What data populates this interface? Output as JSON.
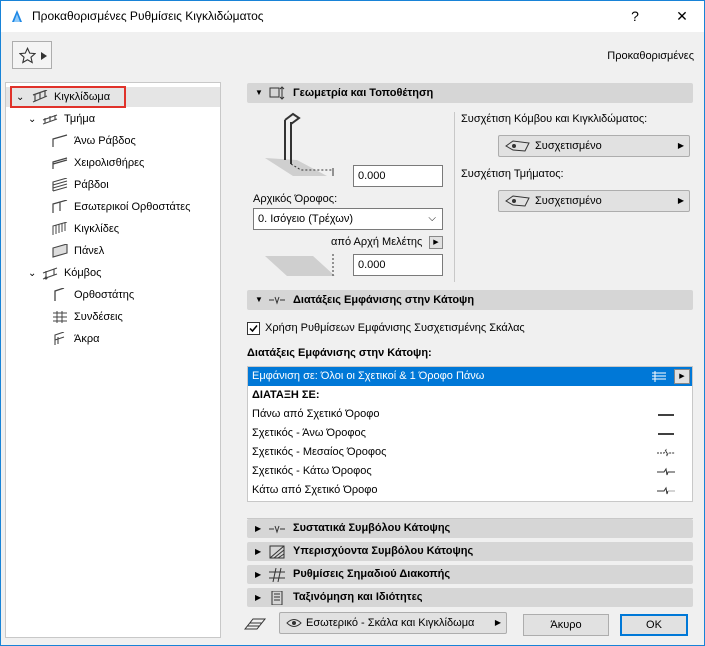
{
  "window": {
    "title": "Προκαθορισμένες Ρυθμίσεις Κιγκλιδώματος",
    "help_label": "?",
    "close_label": "✕"
  },
  "toolbar": {
    "favorites_icon": "star-icon",
    "mode_label": "Προκαθορισμένες"
  },
  "tree": {
    "root": {
      "label": "Κιγκλίδωμα",
      "icon": "railing-icon"
    },
    "segment": {
      "label": "Τμήμα",
      "icon": "segment-icon"
    },
    "segment_children": [
      {
        "label": "Άνω Ράβδος",
        "icon": "top-rail-icon"
      },
      {
        "label": "Χειρολισθήρες",
        "icon": "handrail-icon"
      },
      {
        "label": "Ράβδοι",
        "icon": "rails-icon"
      },
      {
        "label": "Εσωτερικοί Ορθοστάτες",
        "icon": "inner-post-icon"
      },
      {
        "label": "Κιγκλίδες",
        "icon": "baluster-icon"
      },
      {
        "label": "Πάνελ",
        "icon": "panel-icon"
      }
    ],
    "node": {
      "label": "Κόμβος",
      "icon": "node-icon"
    },
    "node_children": [
      {
        "label": "Ορθοστάτης",
        "icon": "post-icon"
      },
      {
        "label": "Συνδέσεις",
        "icon": "connections-icon"
      },
      {
        "label": "Άκρα",
        "icon": "ends-icon"
      }
    ]
  },
  "geometry": {
    "title": "Γεωμετρία και Τοποθέτηση",
    "height_value": "0.000",
    "home_story_label": "Αρχικός Όροφος:",
    "home_story_value": "0. Ισόγειο (Τρέχων)",
    "offset_from_label": "από Αρχή Μελέτης",
    "offset_value": "0.000",
    "node_assoc_label": "Συσχέτιση Κόμβου και Κιγκλιδώματος:",
    "node_assoc_value": "Συσχετισμένο",
    "segment_assoc_label": "Συσχέτιση Τμήματος:",
    "segment_assoc_value": "Συσχετισμένο"
  },
  "floorplan": {
    "title": "Διατάξεις Εμφάνισης στην Κάτοψη",
    "use_stair_settings_label": "Χρήση Ρυθμίσεων Εμφάνισης Συσχετισμένης Σκάλας",
    "use_stair_settings_checked": true,
    "list_title": "Διατάξεις Εμφάνισης στην Κάτοψη:",
    "show_on_label": "Εμφάνιση σε: Όλοι οι Σχετικοί & 1 Όροφο Πάνω",
    "layout_header": "ΔΙΑΤΑΞΗ ΣΕ:",
    "rows": [
      {
        "label": "Πάνω από Σχετικό Όροφο",
        "line": "solid"
      },
      {
        "label": "Σχετικός - Άνω Όροφος",
        "line": "solid"
      },
      {
        "label": "Σχετικός - Μεσαίος Όροφος",
        "line": "break-dashed"
      },
      {
        "label": "Σχετικός - Κάτω Όροφος",
        "line": "break-solid"
      },
      {
        "label": "Κάτω από Σχετικό Όροφο",
        "line": "break-end"
      }
    ]
  },
  "collapsed_sections": [
    {
      "label": "Συστατικά Συμβόλου Κάτοψης",
      "icon": "symbol-components-icon"
    },
    {
      "label": "Υπερισχύοντα Συμβόλου Κάτοψης",
      "icon": "symbol-override-icon"
    },
    {
      "label": "Ρυθμίσεις Σημαδιού Διακοπής",
      "icon": "break-mark-icon"
    },
    {
      "label": "Ταξινόμηση και Ιδιότητες",
      "icon": "classification-icon"
    }
  ],
  "footer": {
    "layer_value": "Εσωτερικό - Σκάλα και Κιγκλίδωμα",
    "cancel_label": "Άκυρο",
    "ok_label": "OK"
  },
  "colors": {
    "accent": "#0078d7",
    "highlight_red": "#e0322a",
    "section_bg": "#d6d6d6"
  }
}
